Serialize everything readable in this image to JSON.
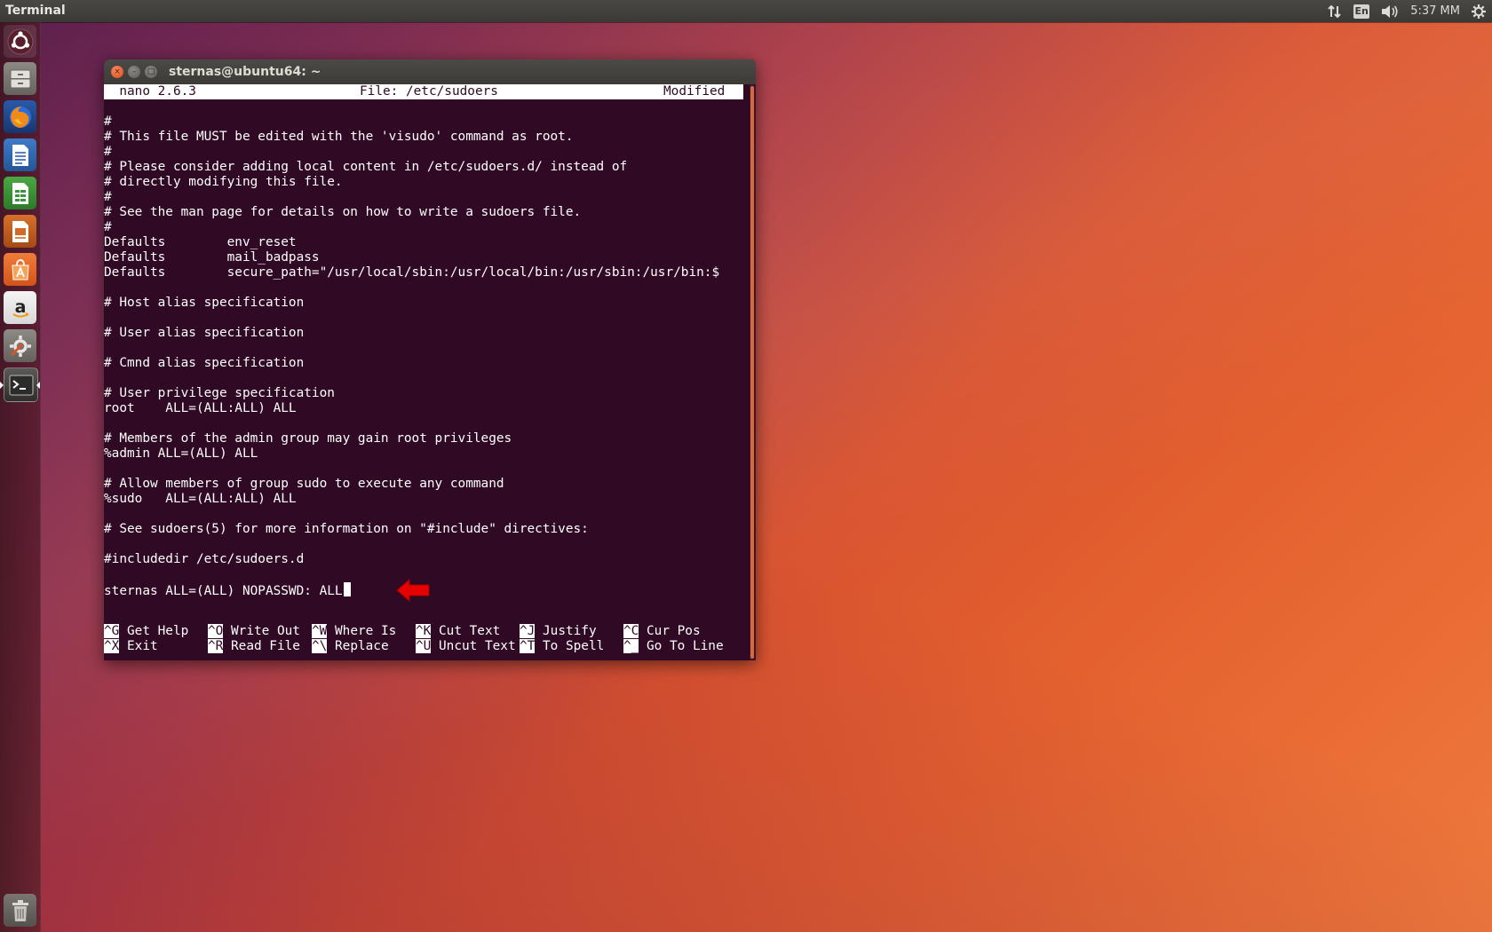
{
  "top_panel": {
    "app_title": "Terminal",
    "keyboard_layout": "En",
    "clock": "5:37 MM",
    "icons": [
      "network-transfer-icon",
      "keyboard-layout-icon",
      "volume-icon",
      "settings-gear-icon"
    ]
  },
  "launcher": {
    "items": [
      {
        "name": "ubuntu-dash",
        "icon": "ubuntu-logo-icon"
      },
      {
        "name": "files",
        "icon": "file-cabinet-icon"
      },
      {
        "name": "firefox",
        "icon": "firefox-icon"
      },
      {
        "name": "libreoffice-writer",
        "icon": "writer-document-icon"
      },
      {
        "name": "libreoffice-calc",
        "icon": "calc-spreadsheet-icon"
      },
      {
        "name": "libreoffice-impress",
        "icon": "impress-presentation-icon"
      },
      {
        "name": "ubuntu-software",
        "icon": "software-center-bag-icon"
      },
      {
        "name": "amazon",
        "icon": "amazon-a-icon"
      },
      {
        "name": "system-settings",
        "icon": "settings-tools-icon"
      },
      {
        "name": "terminal",
        "icon": "terminal-prompt-icon"
      },
      {
        "name": "trash",
        "icon": "trash-bin-icon"
      }
    ]
  },
  "window": {
    "title": "sternas@ubuntu64: ~",
    "buttons": {
      "close": "×",
      "minimize": "–",
      "maximize": "□"
    }
  },
  "nano": {
    "version": "  nano 2.6.3",
    "file_label": "File: /etc/sudoers",
    "status": "Modified",
    "lines": [
      "#",
      "# This file MUST be edited with the 'visudo' command as root.",
      "#",
      "# Please consider adding local content in /etc/sudoers.d/ instead of",
      "# directly modifying this file.",
      "#",
      "# See the man page for details on how to write a sudoers file.",
      "#",
      "Defaults        env_reset",
      "Defaults        mail_badpass",
      "Defaults        secure_path=\"/usr/local/sbin:/usr/local/bin:/usr/sbin:/usr/bin:$",
      "",
      "# Host alias specification",
      "",
      "# User alias specification",
      "",
      "# Cmnd alias specification",
      "",
      "# User privilege specification",
      "root    ALL=(ALL:ALL) ALL",
      "",
      "# Members of the admin group may gain root privileges",
      "%admin ALL=(ALL) ALL",
      "",
      "# Allow members of group sudo to execute any command",
      "%sudo   ALL=(ALL:ALL) ALL",
      "",
      "# See sudoers(5) for more information on \"#include\" directives:",
      "",
      "#includedir /etc/sudoers.d",
      "",
      "sternas ALL=(ALL) NOPASSWD: ALL"
    ],
    "shortcuts_row1": [
      {
        "key": "^G",
        "label": " Get Help"
      },
      {
        "key": "^O",
        "label": " Write Out"
      },
      {
        "key": "^W",
        "label": " Where Is"
      },
      {
        "key": "^K",
        "label": " Cut Text"
      },
      {
        "key": "^J",
        "label": " Justify"
      },
      {
        "key": "^C",
        "label": " Cur Pos"
      }
    ],
    "shortcuts_row2": [
      {
        "key": "^X",
        "label": " Exit"
      },
      {
        "key": "^R",
        "label": " Read File"
      },
      {
        "key": "^\\",
        "label": " Replace"
      },
      {
        "key": "^U",
        "label": " Uncut Text"
      },
      {
        "key": "^T",
        "label": " To Spell"
      },
      {
        "key": "^_",
        "label": " Go To Line"
      }
    ]
  },
  "colors": {
    "terminal_bg": "#300a24",
    "terminal_fg": "#ffffff",
    "arrow": "#e60000",
    "scroll_accent": "#d86a3a"
  }
}
